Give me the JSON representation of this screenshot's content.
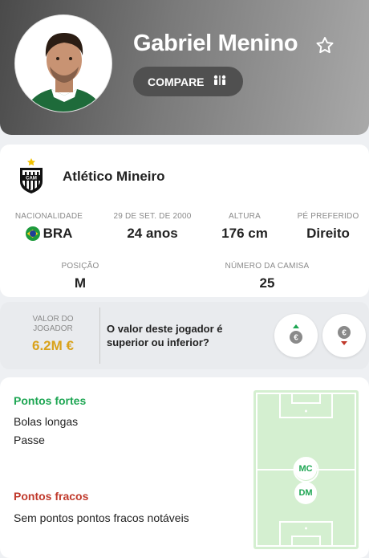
{
  "player": {
    "name": "Gabriel Menino",
    "compare_label": "COMPARE"
  },
  "club": {
    "name": "Atlético Mineiro",
    "logo": "atletico-mineiro-crest"
  },
  "stats_row1": [
    {
      "label": "NACIONALIDADE",
      "value": "BRA",
      "icon": "brazil-flag-icon"
    },
    {
      "label": "29 DE SET. DE 2000",
      "value": "24 anos"
    },
    {
      "label": "ALTURA",
      "value": "176 cm"
    },
    {
      "label": "PÉ PREFERIDO",
      "value": "Direito"
    }
  ],
  "stats_row2": [
    {
      "label": "POSIÇÃO",
      "value": "M"
    },
    {
      "label": "NÚMERO DA CAMISA",
      "value": "25"
    }
  ],
  "value": {
    "label": "VALOR DO JOGADOR",
    "amount": "6.2M €",
    "question": "O valor deste jogador é superior ou inferior?",
    "up_icon": "value-up-icon",
    "down_icon": "value-down-icon"
  },
  "strengths": {
    "title": "Pontos fortes",
    "items": [
      "Bolas longas",
      "Passe"
    ]
  },
  "weaknesses": {
    "title": "Pontos fracos",
    "items": [
      "Sem pontos pontos fracos notáveis"
    ]
  },
  "pitch": {
    "positions": [
      "MC",
      "DM"
    ]
  },
  "colors": {
    "green": "#1ea653",
    "red": "#c0392b",
    "gold": "#d9a21b",
    "pitch": "#d4efd0",
    "pitch_line": "#ffffff"
  }
}
